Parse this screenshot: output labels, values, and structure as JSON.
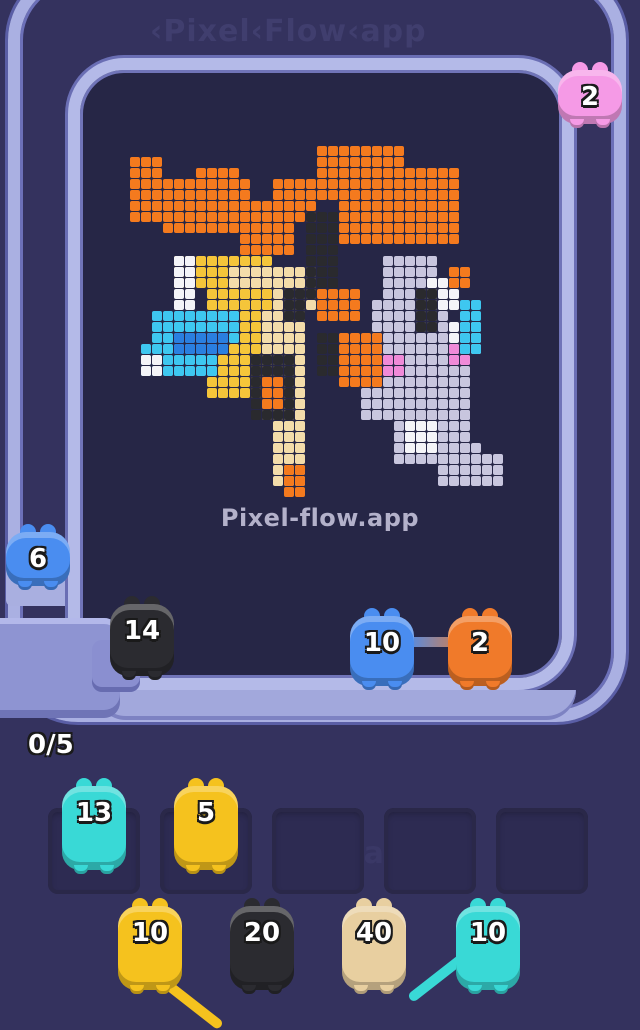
{
  "watermark_text": "Pixel-flow.app",
  "progress": {
    "text": "0/5"
  },
  "colors": {
    "bg": "#34325e",
    "board": "#262646",
    "track": "#aab0e2",
    "orange": "#f47a1e",
    "yellow": "#f5c53a",
    "cream": "#f3dcaa",
    "cyan": "#3ec7f0",
    "blue": "#2a7fe0",
    "grey": "#c8c6de",
    "white": "#f4f4f8",
    "black": "#2a2a2e",
    "pink": "#f08ad8"
  },
  "conveyor_pigs": [
    {
      "id": "pink",
      "count": "2",
      "color": "#f59ae6"
    },
    {
      "id": "blue-left",
      "count": "6",
      "color": "#4a8df0"
    },
    {
      "id": "black-entry",
      "count": "14",
      "color": "#2b2b30"
    },
    {
      "id": "blue-lane",
      "count": "10",
      "color": "#4a8df0"
    },
    {
      "id": "orange-lane",
      "count": "2",
      "color": "#f07a2a"
    }
  ],
  "slot_pigs": [
    {
      "id": "cyan-slot",
      "count": "13",
      "color": "#39d9d6"
    },
    {
      "id": "yellow-slot",
      "count": "5",
      "color": "#f5c21e"
    }
  ],
  "queue_pigs": [
    {
      "id": "yellow-queue",
      "count": "10",
      "color": "#f5c21e"
    },
    {
      "id": "black-queue",
      "count": "20",
      "color": "#2b2b30"
    },
    {
      "id": "cream-queue",
      "count": "40",
      "color": "#e8cfa0"
    },
    {
      "id": "cyan-queue",
      "count": "10",
      "color": "#39d9d6"
    }
  ],
  "empty_slots": 3
}
